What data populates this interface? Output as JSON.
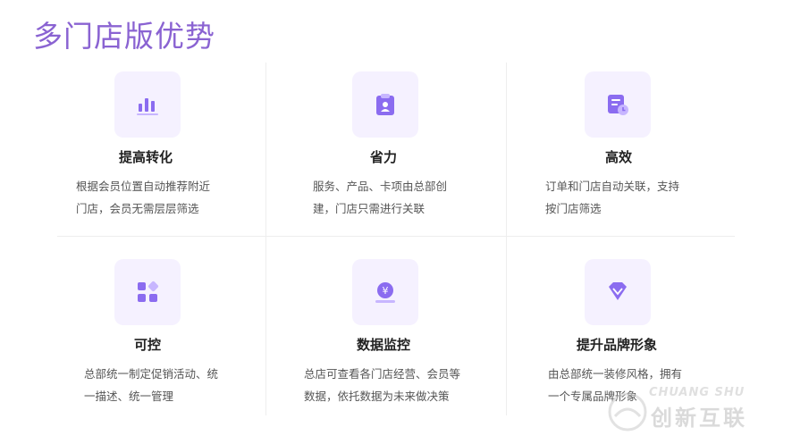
{
  "header": {
    "title": "多门店版优势"
  },
  "features": [
    {
      "title": "提高转化",
      "icon": "bar-chart-icon",
      "desc": [
        "根据会员位置自动推荐附近",
        "门店，会员无需层层筛选"
      ]
    },
    {
      "title": "省力",
      "icon": "clipboard-user-icon",
      "desc": [
        "服务、产品、卡项由总部创",
        "建，门店只需进行关联"
      ]
    },
    {
      "title": "高效",
      "icon": "document-clock-icon",
      "desc": [
        "订单和门店自动关联，支持",
        "按门店筛选"
      ]
    },
    {
      "title": "可控",
      "icon": "apps-grid-icon",
      "desc": [
        "总部统一制定促销活动、统",
        "一描述、统一管理"
      ]
    },
    {
      "title": "数据监控",
      "icon": "yen-coin-icon",
      "desc": [
        "总店可查看各门店经营、会员等",
        "数据，依托数据为未来做决策"
      ]
    },
    {
      "title": "提升品牌形象",
      "icon": "gem-icon",
      "desc": [
        "由总部统一装修风格，拥有",
        "一个专属品牌形象"
      ]
    }
  ],
  "watermark": {
    "en": "CHUANG  SHU",
    "cn": "创新互联"
  },
  "colors": {
    "accent": "#8a63d2",
    "icon_bg": "#f5f1ff",
    "icon_fg": "#8b6cf0"
  }
}
